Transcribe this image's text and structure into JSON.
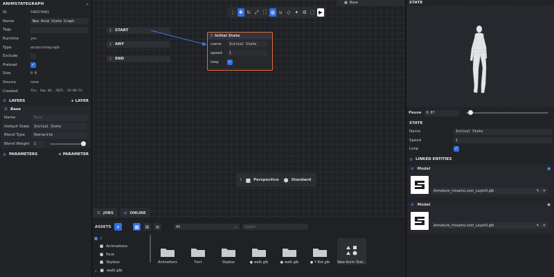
{
  "inspector": {
    "title": "ANIMSTATEGRAPH",
    "collapse_icon": "double-chevron-left-icon",
    "props": [
      {
        "label": "ID",
        "value": "546974081"
      },
      {
        "label": "Name",
        "value": "New Anim State Graph"
      },
      {
        "label": "Tags",
        "value": ""
      },
      {
        "label": "Runtime",
        "value": "yes"
      },
      {
        "label": "Type",
        "value": "animstategraph"
      },
      {
        "label": "Exclude",
        "value": ""
      },
      {
        "label": "Preload",
        "value": "✓"
      },
      {
        "label": "Size",
        "value": "0 B"
      },
      {
        "label": "Source",
        "value": "none"
      },
      {
        "label": "Created",
        "value": "Thu, Sep 04, 2025, 10:00:51"
      }
    ],
    "layers": {
      "title": "LAYERS",
      "add_label": "LAYER"
    },
    "layer": {
      "name": "Base",
      "rows": [
        {
          "label": "Name",
          "value": "Base"
        },
        {
          "label": "Default State",
          "value": "Initial State"
        },
        {
          "label": "Blend Type",
          "value": "Overwrite"
        },
        {
          "label": "Blend Weight",
          "value": "1"
        }
      ]
    },
    "parameters": {
      "title": "PARAMETERS",
      "add_label": "PARAMETER"
    }
  },
  "graph": {
    "layer_tab": "Base",
    "nodes": {
      "start": "START",
      "any": "ANY",
      "end": "END"
    },
    "state_node": {
      "title": "Initial State",
      "name_label": "name",
      "name_value": "Initial State",
      "speed_label": "speed",
      "speed_value": "1",
      "loop_label": "loop",
      "loop_value": "✓"
    },
    "view": {
      "camera": "Perspective",
      "mode": "Standard"
    },
    "tabs": {
      "jobs": "JOBS",
      "online": "ONLINE"
    }
  },
  "assets": {
    "title": "ASSETS",
    "filter": "All",
    "search_placeholder": "Search",
    "tree": [
      "/",
      "Animations",
      "Font",
      "Skybox",
      "walk.glb"
    ],
    "items": [
      "Animations",
      "Font",
      "Skybox",
      "● walk.glb",
      "● walk.glb",
      "● Y Bot.glb",
      "New Anim Stat..."
    ]
  },
  "state_panel": {
    "title": "STATE",
    "pause_label": "Pause",
    "time_value": "0.07",
    "time_progress": 0.03,
    "section": "STATE",
    "rows": [
      {
        "label": "Name",
        "value": "Initial State"
      },
      {
        "label": "Speed",
        "value": "1"
      },
      {
        "label": "Loop",
        "value": "✓"
      }
    ],
    "linked_title": "LINKED ENTITIES",
    "models": [
      {
        "title": "Model",
        "file": "Armature_mixamo.com_Layer0.glb"
      },
      {
        "title": "Model",
        "file": "Armature_mixamo.com_Layer0.glb"
      }
    ]
  },
  "colors": {
    "accent": "#2f6fe4",
    "selected_node": "#e86a3f",
    "start_icon": "#6cbf4f",
    "end_icon": "#e05a4b"
  }
}
